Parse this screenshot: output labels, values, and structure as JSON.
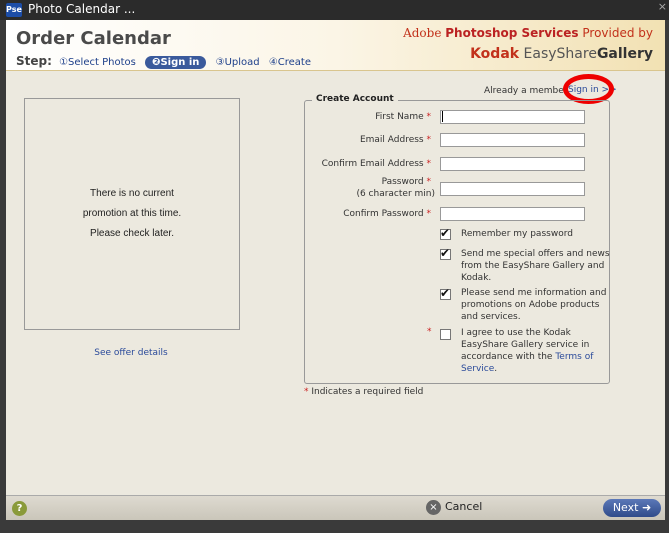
{
  "window": {
    "app_icon": "Pse",
    "title": "Photo Calendar ...",
    "close": "×"
  },
  "header": {
    "title": "Order Calendar",
    "step_label": "Step:",
    "steps": [
      "①Select Photos",
      "❷Sign in",
      "③Upload",
      "④Create"
    ],
    "adobe_prefix": "Adobe",
    "adobe_service": "Photoshop Services",
    "adobe_suffix": " Provided by",
    "kodak_brand": "Kodak",
    "kodak_easyshare": "EasyShare",
    "kodak_gallery": "Gallery"
  },
  "promo": {
    "line1": "There is no current",
    "line2": "promotion at this time.",
    "line3": "Please check later.",
    "offer_link": "See offer details"
  },
  "account": {
    "already_member": "Already a membe",
    "sign_in_link": "Sign in >>",
    "legend": "Create Account",
    "fields": [
      {
        "label": "First Name",
        "value": ""
      },
      {
        "label": "Email Address",
        "value": ""
      },
      {
        "label": "Confirm Email Address",
        "value": ""
      },
      {
        "label": "Password",
        "hint": "(6 character min)",
        "value": ""
      },
      {
        "label": "Confirm Password",
        "value": ""
      }
    ],
    "required_star": "*",
    "checkboxes": [
      {
        "text": "Remember my password",
        "checked": true
      },
      {
        "text": "Send me special offers and news from the EasyShare Gallery and Kodak.",
        "checked": true
      },
      {
        "text": "Please send me information and promotions on Adobe products and services.",
        "checked": true
      },
      {
        "text_before": "I agree to use the Kodak EasyShare Gallery service in accordance with the ",
        "link": "Terms of Service",
        "text_after": ".",
        "checked": false
      }
    ],
    "required_note": " Indicates a required field"
  },
  "footer": {
    "help": "?",
    "cancel": "Cancel",
    "cancel_icon": "×",
    "next": "Next ➜"
  }
}
